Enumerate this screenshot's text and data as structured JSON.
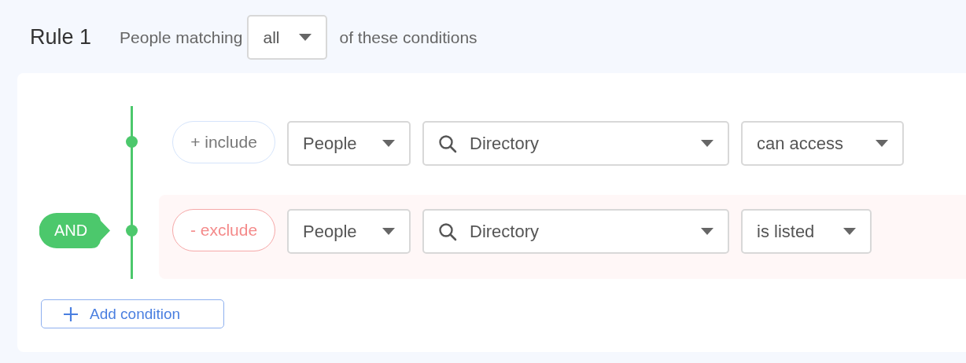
{
  "rule": {
    "title": "Rule 1",
    "prefix": "People matching",
    "match": "all",
    "suffix": "of these conditions"
  },
  "operator": "AND",
  "conditions": [
    {
      "kind": "include",
      "pill": "+ include",
      "subject": "People",
      "target": "Directory",
      "verb": "can access"
    },
    {
      "kind": "exclude",
      "pill": "- exclude",
      "subject": "People",
      "target": "Directory",
      "verb": "is listed"
    }
  ],
  "add_button": "Add condition"
}
